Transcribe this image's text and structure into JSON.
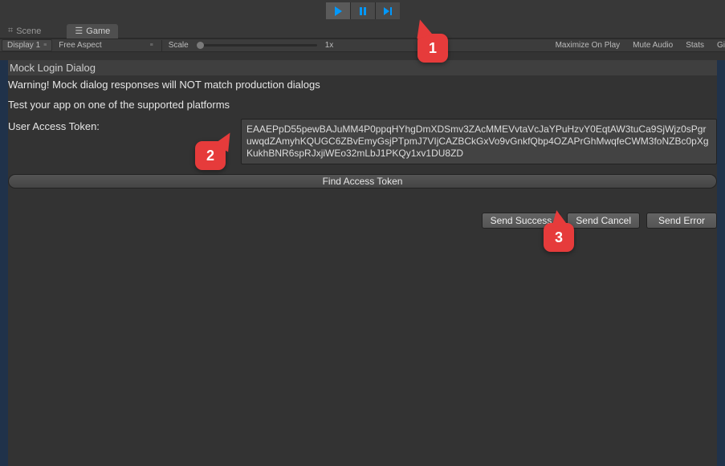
{
  "playback": {
    "play_active": true
  },
  "tabs": {
    "scene": "Scene",
    "game": "Game"
  },
  "toolbar": {
    "display": "Display 1",
    "aspect": "Free Aspect",
    "scale_label": "Scale",
    "scale_value": "1x",
    "maximize": "Maximize On Play",
    "mute": "Mute Audio",
    "stats": "Stats",
    "gizmos": "Gi"
  },
  "dialog": {
    "title": "Mock Login Dialog",
    "warning": "Warning! Mock dialog responses will NOT match production dialogs",
    "subline": "Test your app on one of the supported platforms",
    "token_label": "User Access Token:",
    "token_value": "EAAEPpD55pewBAJuMM4P0ppqHYhgDmXDSmv3ZAcMMEVvtaVcJaYPuHzvY0EqtAW3tuCa9SjWjz0sPgruwqdZAmyhKQUGC6ZBvEmyGsjPTpmJ7VIjCAZBCkGxVo9vGnkfQbp4OZAPrGhMwqfeCWM3foNZBc0pXgKukhBNR6spRJxjiWEo32mLbJ1PKQy1xv1DU8ZD",
    "find_button": "Find Access Token",
    "send_success": "Send Success",
    "send_cancel": "Send Cancel",
    "send_error": "Send Error"
  },
  "annotations": {
    "c1": "1",
    "c2": "2",
    "c3": "3"
  }
}
